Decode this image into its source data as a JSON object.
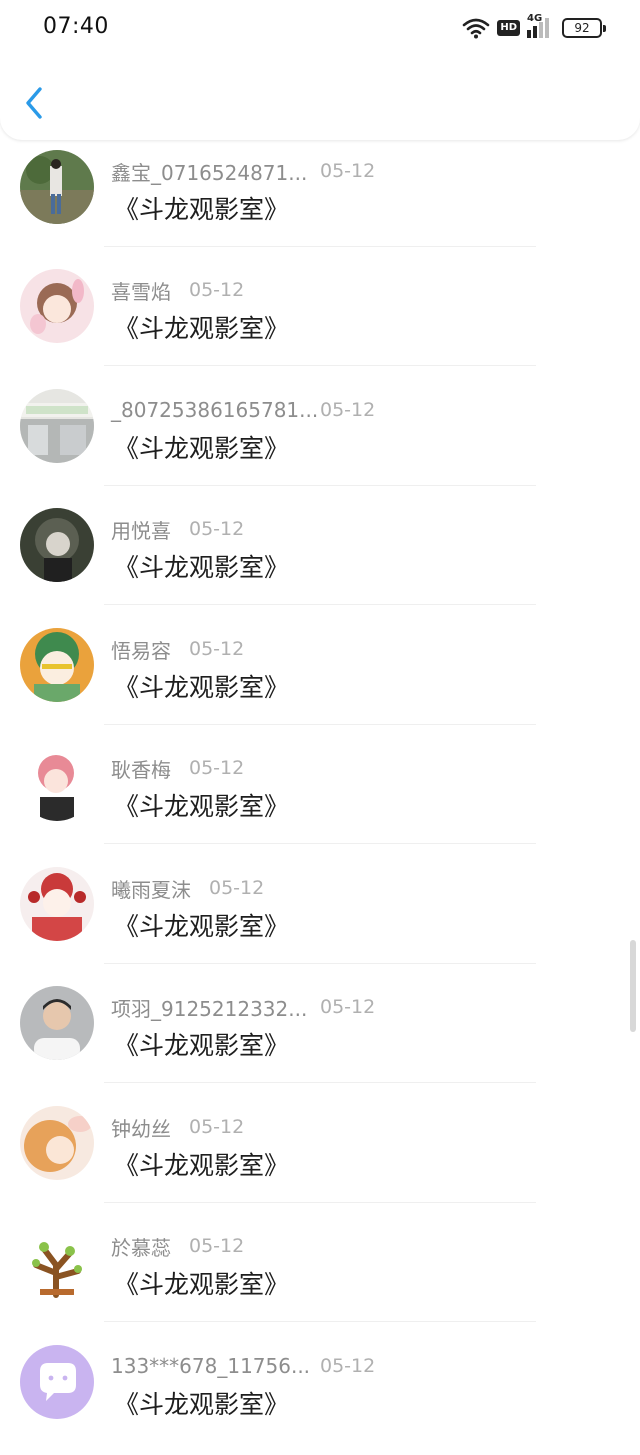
{
  "status_bar": {
    "time": "07:40",
    "hd_label": "HD",
    "network": "4G",
    "battery": "92"
  },
  "nav": {
    "back_icon": "chevron-left-icon",
    "accent_color": "#2a9ae8"
  },
  "items": [
    {
      "name": "鑫宝_0716524871...",
      "date": "05-12",
      "title": "《斗龙观影室》",
      "long": true
    },
    {
      "name": "喜雪焰",
      "date": "05-12",
      "title": "《斗龙观影室》",
      "long": false
    },
    {
      "name": "_80725386165781...",
      "date": "05-12",
      "title": "《斗龙观影室》",
      "long": true
    },
    {
      "name": "用悦喜",
      "date": "05-12",
      "title": "《斗龙观影室》",
      "long": false
    },
    {
      "name": "悟易容",
      "date": "05-12",
      "title": "《斗龙观影室》",
      "long": false
    },
    {
      "name": "耿香梅",
      "date": "05-12",
      "title": "《斗龙观影室》",
      "long": false
    },
    {
      "name": "曦雨夏沫",
      "date": "05-12",
      "title": "《斗龙观影室》",
      "long": false
    },
    {
      "name": "项羽_9125212332...",
      "date": "05-12",
      "title": "《斗龙观影室》",
      "long": true
    },
    {
      "name": "钟幼丝",
      "date": "05-12",
      "title": "《斗龙观影室》",
      "long": false
    },
    {
      "name": "於慕蕊",
      "date": "05-12",
      "title": "《斗龙观影室》",
      "long": false
    },
    {
      "name": "133***678_11756...",
      "date": "05-12",
      "title": "《斗龙观影室》",
      "long": true
    }
  ]
}
